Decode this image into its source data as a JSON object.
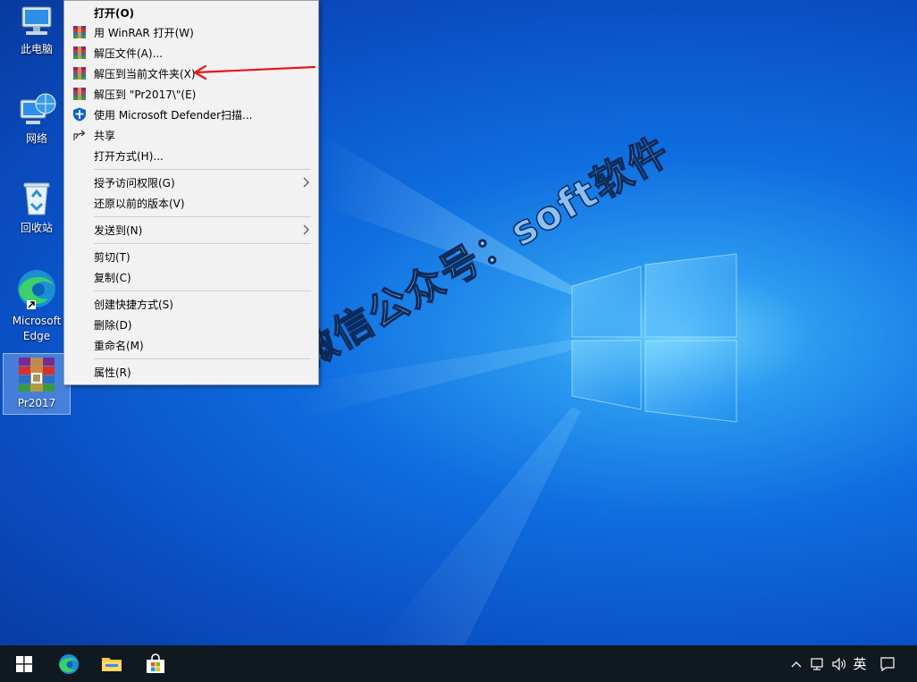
{
  "desktop": {
    "icons": [
      {
        "label": "此电脑",
        "icon": "computer-icon"
      },
      {
        "label": "网络",
        "icon": "network-icon"
      },
      {
        "label": "回收站",
        "icon": "recycle-bin-icon"
      },
      {
        "label": "Microsoft Edge",
        "icon": "edge-icon"
      },
      {
        "label": "Pr2017",
        "icon": "winrar-archive-icon",
        "selected": true
      }
    ]
  },
  "watermark": "微信公众号：soft软件",
  "context_menu": {
    "items": [
      {
        "label": "打开(O)",
        "icon": "",
        "bold": true
      },
      {
        "label": "用 WinRAR 打开(W)",
        "icon": "winrar-icon"
      },
      {
        "label": "解压文件(A)...",
        "icon": "winrar-icon"
      },
      {
        "label": "解压到当前文件夹(X)",
        "icon": "winrar-icon",
        "highlighted_by_arrow": true
      },
      {
        "label": "解压到 \"Pr2017\\\"(E)",
        "icon": "winrar-icon"
      },
      {
        "label": "使用 Microsoft Defender扫描...",
        "icon": "defender-shield-icon"
      },
      {
        "label": "共享",
        "icon": "share-icon"
      },
      {
        "label": "打开方式(H)...",
        "icon": ""
      },
      {
        "label": "授予访问权限(G)",
        "icon": "",
        "submenu": true
      },
      {
        "label": "还原以前的版本(V)",
        "icon": ""
      },
      {
        "label": "发送到(N)",
        "icon": "",
        "submenu": true
      },
      {
        "label": "剪切(T)",
        "icon": ""
      },
      {
        "label": "复制(C)",
        "icon": ""
      },
      {
        "label": "创建快捷方式(S)",
        "icon": ""
      },
      {
        "label": "删除(D)",
        "icon": ""
      },
      {
        "label": "重命名(M)",
        "icon": ""
      },
      {
        "label": "属性(R)",
        "icon": ""
      }
    ]
  },
  "annotation": {
    "color": "#e8161b"
  },
  "taskbar": {
    "pinned": [
      "start-icon",
      "edge-icon",
      "file-explorer-icon",
      "microsoft-store-icon"
    ],
    "tray": {
      "ime_label": "英"
    }
  }
}
